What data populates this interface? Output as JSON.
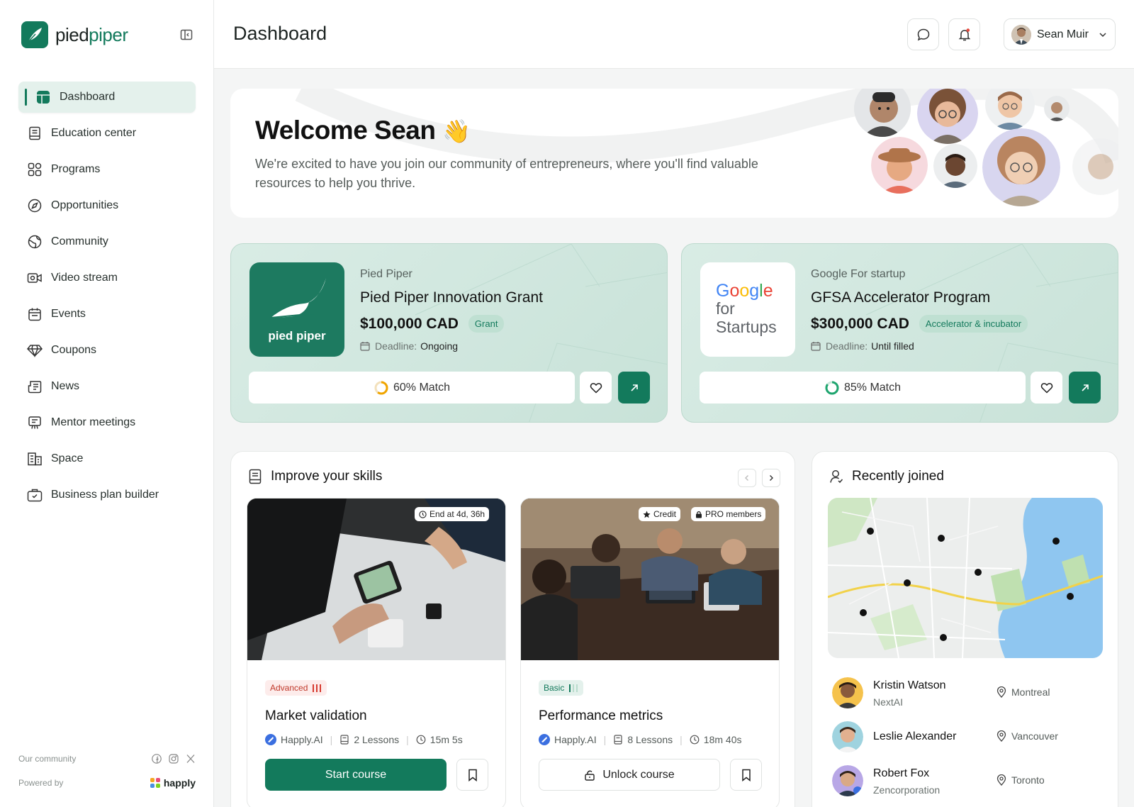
{
  "brand": {
    "name_part1": "pied",
    "name_part2": "piper",
    "accent": "#137a5c"
  },
  "sidebar": {
    "items": [
      {
        "label": "Dashboard",
        "icon": "dashboard-icon",
        "active": true
      },
      {
        "label": "Education center",
        "icon": "book-icon"
      },
      {
        "label": "Programs",
        "icon": "programs-icon"
      },
      {
        "label": "Opportunities",
        "icon": "compass-icon"
      },
      {
        "label": "Community",
        "icon": "globe-icon"
      },
      {
        "label": "Video stream",
        "icon": "video-icon"
      },
      {
        "label": "Events",
        "icon": "calendar-icon"
      },
      {
        "label": "Coupons",
        "icon": "diamond-icon"
      },
      {
        "label": "News",
        "icon": "news-icon"
      },
      {
        "label": "Mentor meetings",
        "icon": "presentation-icon"
      },
      {
        "label": "Space",
        "icon": "building-icon"
      },
      {
        "label": "Business plan builder",
        "icon": "briefcase-icon"
      }
    ],
    "footer": {
      "community_label": "Our community",
      "powered_label": "Powered by",
      "powered_brand": "happly"
    }
  },
  "header": {
    "title": "Dashboard",
    "user_name": "Sean Muir"
  },
  "welcome": {
    "title": "Welcome Sean",
    "emoji": "👋",
    "text": "We're excited to have you join our community of entrepreneurs, where you'll find valuable resources to help you thrive."
  },
  "opportunities": [
    {
      "org": "Pied Piper",
      "title": "Pied Piper Innovation Grant",
      "amount": "$100,000 CAD",
      "tag": "Grant",
      "deadline_label": "Deadline:",
      "deadline": "Ongoing",
      "match": "60% Match",
      "match_fraction": 0.6,
      "logo_text": "pied piper"
    },
    {
      "org": "Google For startup",
      "title": "GFSA Accelerator Program",
      "amount": "$300,000 CAD",
      "tag": "Accelerator & incubator",
      "deadline_label": "Deadline:",
      "deadline": "Until filled",
      "match": "85% Match",
      "match_fraction": 0.85,
      "logo_text": [
        "Google",
        "for",
        "Startups"
      ]
    }
  ],
  "skills": {
    "title": "Improve your skills",
    "courses": [
      {
        "badges": [
          "End at 4d, 36h"
        ],
        "level": "Advanced",
        "title": "Market validation",
        "provider": "Happly.AI",
        "lessons": "2 Lessons",
        "duration": "15m 5s",
        "button": "Start course"
      },
      {
        "badges": [
          "Credit",
          "PRO members"
        ],
        "level": "Basic",
        "title": "Performance metrics",
        "provider": "Happly.AI",
        "lessons": "8 Lessons",
        "duration": "18m 40s",
        "button": "Unlock course"
      }
    ]
  },
  "recent": {
    "title": "Recently joined",
    "members": [
      {
        "name": "Kristin Watson",
        "org": "NextAI",
        "location": "Montreal"
      },
      {
        "name": "Leslie Alexander",
        "org": "",
        "location": "Vancouver"
      },
      {
        "name": "Robert Fox",
        "org": "Zencorporation",
        "location": "Toronto"
      }
    ]
  }
}
